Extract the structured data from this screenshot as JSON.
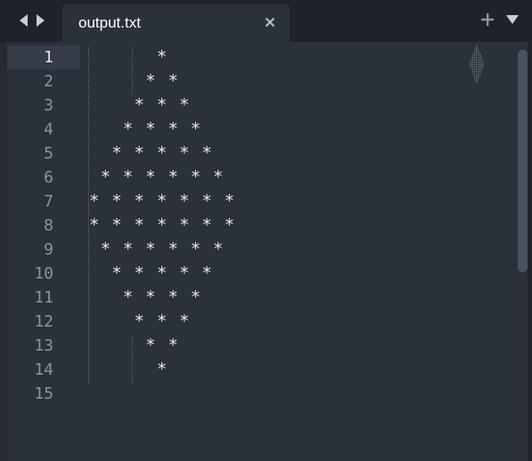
{
  "tab": {
    "title": "output.txt"
  },
  "icons": {
    "back": "chevron-left-icon",
    "forward": "chevron-right-icon",
    "close": "close-icon",
    "new_tab": "plus-icon",
    "tab_menu": "triangle-down-icon"
  },
  "editor": {
    "active_line": 1,
    "line_numbers": [
      "1",
      "2",
      "3",
      "4",
      "5",
      "6",
      "7",
      "8",
      "9",
      "10",
      "11",
      "12",
      "13",
      "14",
      "15"
    ],
    "lines": [
      "      *",
      "     * *",
      "    * * *",
      "   * * * *",
      "  * * * * *",
      " * * * * * *",
      "* * * * * * *",
      "* * * * * * *",
      " * * * * * *",
      "  * * * * *",
      "   * * * *",
      "    * * *",
      "     * *",
      "      *",
      ""
    ]
  },
  "colors": {
    "tabbar_bg": "#1e232b",
    "editor_bg": "#2b313a",
    "text": "#e6e8ea",
    "line_number": "#8c939c"
  }
}
